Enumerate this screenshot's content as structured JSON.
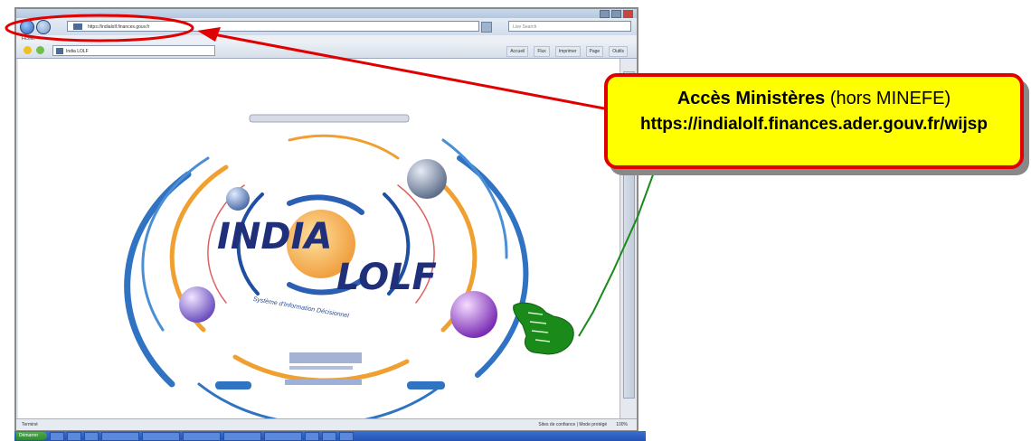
{
  "browser": {
    "address_url": "https://indialolf.finances.gouv.fr",
    "search_placeholder": "Live Search",
    "menu_text": "Fichier",
    "tab_title": "India LOLF",
    "commands": [
      "Accueil",
      "Flux",
      "Imprimer",
      "Page",
      "Outils"
    ],
    "status_left": "Terminé",
    "status_zone": "Sites de confiance | Mode protégé",
    "status_zoom": "100%"
  },
  "taskbar": {
    "start_label": "Démarrer"
  },
  "page": {
    "logo_line1": "INDIA",
    "logo_line2": "LOLF",
    "subtitle_arc": "Système d'Information Décisionnel",
    "colors": {
      "callout_fill": "#ffff00",
      "callout_border": "#e00000",
      "arrow_red": "#e00000",
      "arrow_green": "#1a8a1a"
    }
  },
  "callout": {
    "line1_bold": "Accès Ministères",
    "line1_normal": "(hors MINEFE)",
    "line2": "https://indialolf.finances.ader.gouv.fr/wijsp"
  }
}
